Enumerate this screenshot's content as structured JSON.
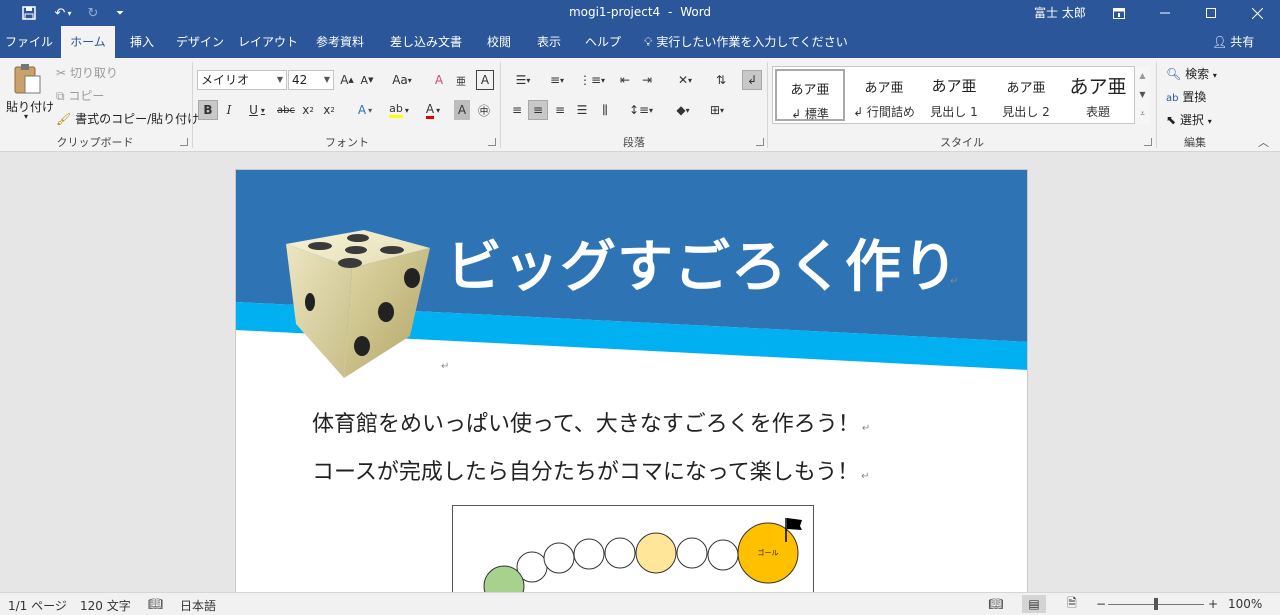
{
  "titlebar": {
    "doc_title": "mogi1-project4",
    "separator": "-",
    "app": "Word",
    "user": "富士 太郎"
  },
  "tabs": [
    "ファイル",
    "ホーム",
    "挿入",
    "デザイン",
    "レイアウト",
    "参考資料",
    "差し込み文書",
    "校閲",
    "表示",
    "ヘルプ"
  ],
  "active_tab": "ホーム",
  "tell_me": "実行したい作業を入力してください",
  "share": "共有",
  "clipboard": {
    "paste": "貼り付け",
    "cut": "切り取り",
    "copy": "コピー",
    "format_painter": "書式のコピー/貼り付け",
    "group_label": "クリップボード"
  },
  "font": {
    "name": "メイリオ",
    "size": "42",
    "group_label": "フォント"
  },
  "paragraph": {
    "group_label": "段落"
  },
  "styles": {
    "items": [
      {
        "preview": "あア亜",
        "name": "↲ 標準",
        "selected": true
      },
      {
        "preview": "あア亜",
        "name": "↲ 行間詰め",
        "selected": false
      },
      {
        "preview": "あア亜",
        "name": "見出し 1",
        "selected": false
      },
      {
        "preview": "あア亜",
        "name": "見出し 2",
        "selected": false
      },
      {
        "preview": "あア亜",
        "name": "表題",
        "selected": false
      }
    ],
    "group_label": "スタイル"
  },
  "editing": {
    "find": "検索",
    "replace": "置換",
    "select": "選択",
    "group_label": "編集"
  },
  "document": {
    "headline": "ビッグすごろく作り",
    "line1": "体育館をめいっぱい使って、大きなすごろくを作ろう！",
    "line2": "コースが完成したら自分たちがコマになって楽しもう！",
    "goal_label": "ゴール",
    "para_mark": "↵"
  },
  "statusbar": {
    "page": "1/1 ページ",
    "words": "120 文字",
    "language": "日本語",
    "zoom": "100%"
  },
  "colors": {
    "word_blue": "#2b579a",
    "banner_blue": "#2e74b5",
    "banner_cyan": "#00b0f0",
    "goal_yellow": "#ffc000",
    "space_yellow": "#ffe699",
    "start_green": "#a9d18e"
  }
}
